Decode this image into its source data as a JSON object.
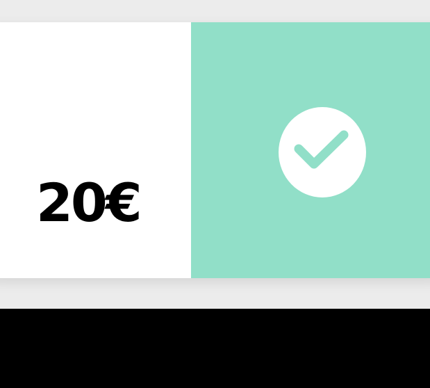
{
  "price_card": {
    "amount": "20€",
    "confirm_icon": "check-circle-icon",
    "accent_color": "#91dfc8"
  }
}
